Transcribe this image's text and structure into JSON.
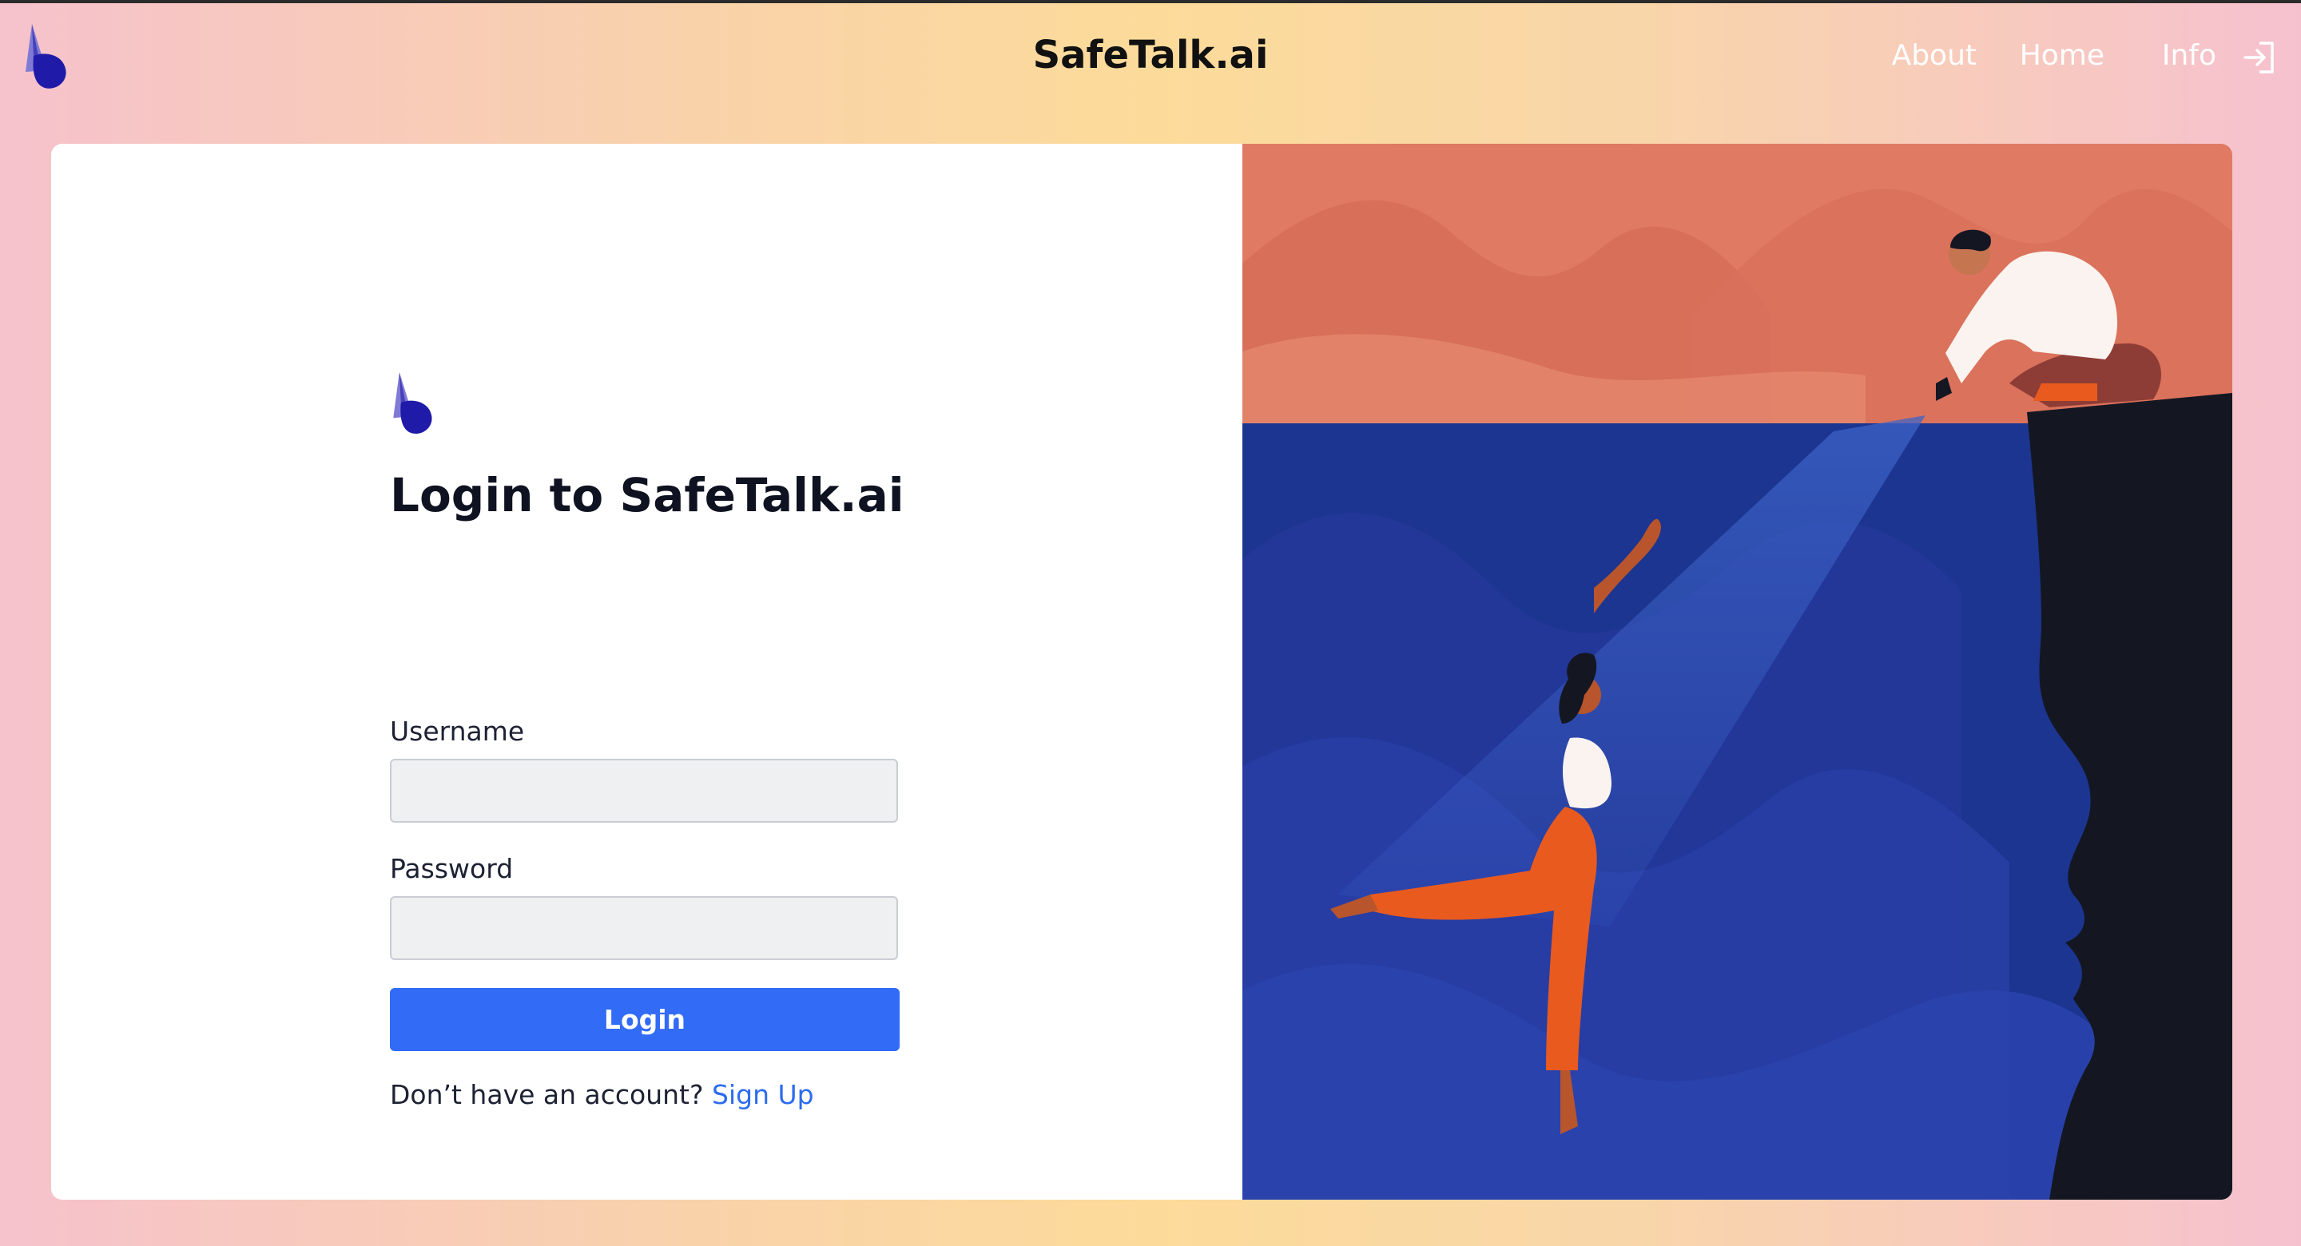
{
  "brand": {
    "title": "SafeTalk.ai",
    "logo_icon": "safetalk-logo-icon"
  },
  "nav": {
    "links": [
      {
        "label": "About"
      },
      {
        "label": "Home"
      },
      {
        "label": "Info"
      }
    ],
    "login_icon": "sign-in-icon"
  },
  "login_form": {
    "title": "Login to SafeTalk.ai",
    "username_label": "Username",
    "username_value": "",
    "password_label": "Password",
    "password_value": "",
    "submit_label": "Login",
    "signup_prompt": "Don’t have an account?",
    "signup_link": "Sign Up"
  },
  "illustration": {
    "description_icon": "helping-hand-illustration"
  },
  "colors": {
    "accent": "#316bf6",
    "link": "#2d6cf0",
    "logo_dark": "#1f1aa8",
    "logo_light": "#7f7ad6",
    "sky": "#e07a62",
    "sea": "#1c3590",
    "cliff": "#141722"
  }
}
